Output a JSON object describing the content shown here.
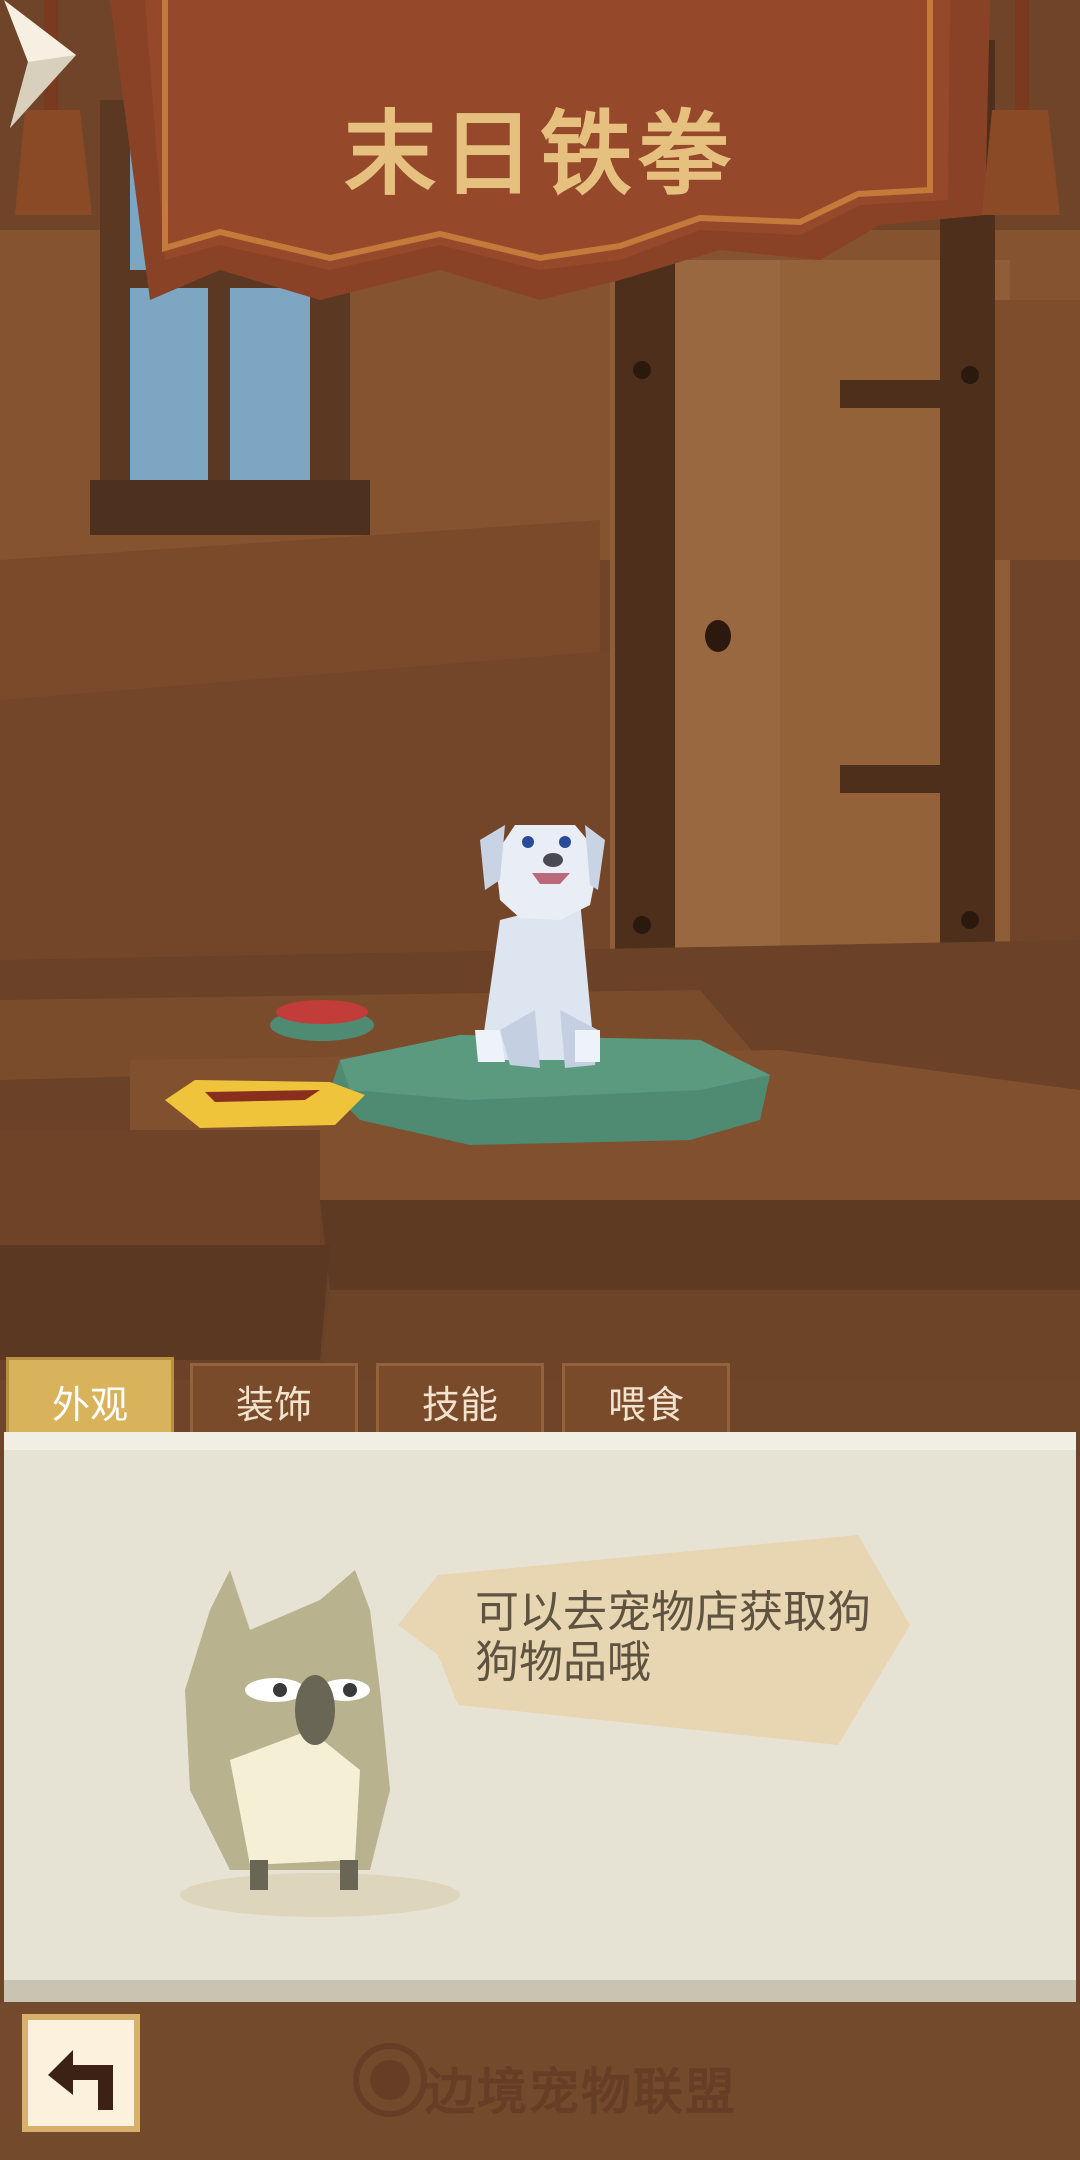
{
  "pet": {
    "name": "末日铁拳",
    "icon": "dog-character"
  },
  "navigation": {
    "next_icon": "chevron-right-icon",
    "back_icon": "back-arrow-icon"
  },
  "tabs": [
    {
      "label": "外观",
      "active": true
    },
    {
      "label": "装饰",
      "active": false
    },
    {
      "label": "技能",
      "active": false
    },
    {
      "label": "喂食",
      "active": false
    }
  ],
  "panel": {
    "hint_text": "可以去宠物店获取狗狗物品哦",
    "mascot_icon": "mascot-character"
  },
  "footer": {
    "logo_text": "边境宠物联盟"
  },
  "colors": {
    "banner": "#8a4226",
    "title": "#e6c07f",
    "active_tab": "#d8b35c",
    "panel": "#e7e3d4"
  }
}
